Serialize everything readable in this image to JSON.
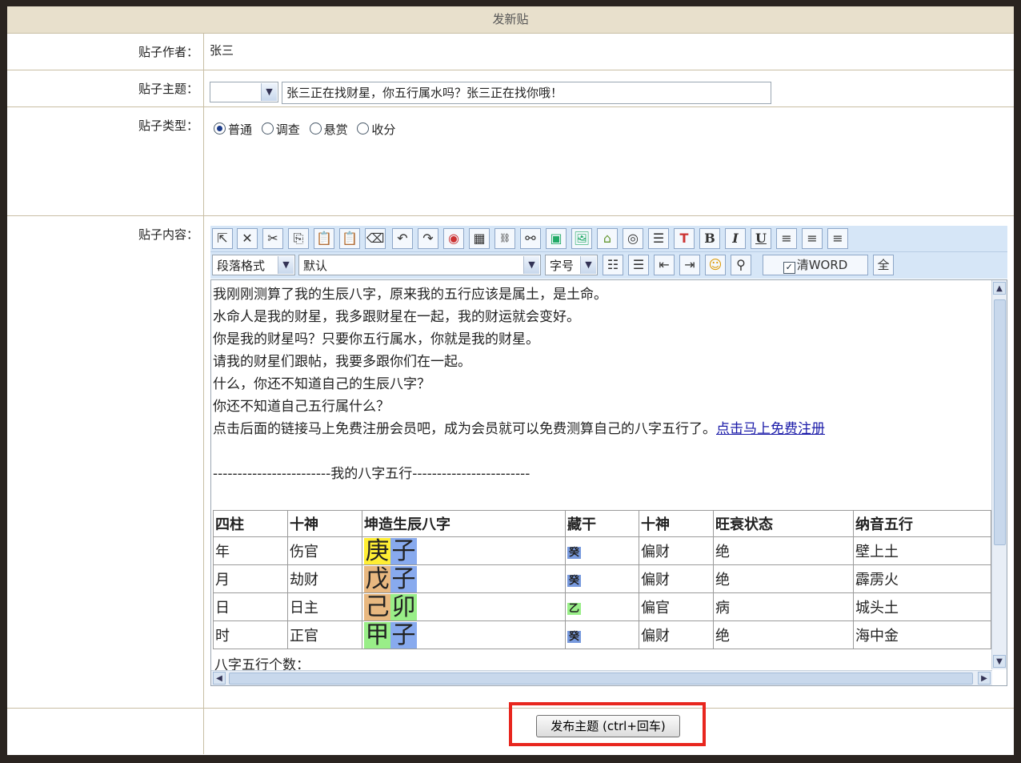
{
  "title": "发新贴",
  "labels": {
    "author": "贴子作者：",
    "subject": "贴子主题：",
    "type": "贴子类型：",
    "content": "贴子内容："
  },
  "author_value": "张三",
  "subject_value": "张三正在找财星，你五行属水吗？张三正在找你哦！",
  "types": [
    {
      "label": "普通",
      "checked": true
    },
    {
      "label": "调查",
      "checked": false
    },
    {
      "label": "悬赏",
      "checked": false
    },
    {
      "label": "收分",
      "checked": false
    }
  ],
  "toolbar2": {
    "paragraph_format": "段落格式",
    "font": "默认",
    "font_size": "字号",
    "clear_word": "清WORD",
    "full": "全"
  },
  "toolbar1_icons": [
    "cursor-icon",
    "delete-icon",
    "cut-icon",
    "copy-icon",
    "paste-icon",
    "paste-text-icon",
    "eraser-icon",
    "undo-icon",
    "redo-icon",
    "stamp-icon",
    "table-icon",
    "web-link-icon",
    "unlink-icon",
    "image-icon",
    "picture-icon",
    "gallery-icon",
    "media-icon",
    "form-icon",
    "text-color-icon",
    "bold-icon",
    "italic-icon",
    "underline-icon",
    "align-left-icon",
    "align-center-icon",
    "align-right-icon"
  ],
  "content_lines": [
    "我刚刚测算了我的生辰八字，原来我的五行应该是属土，是土命。",
    "水命人是我的财星，我多跟财星在一起，我的财运就会变好。",
    "你是我的财星吗？只要你五行属水，你就是我的财星。",
    "请我的财星们跟帖，我要多跟你们在一起。",
    "什么，你还不知道自己的生辰八字？",
    "你还不知道自己五行属什么？",
    "点击后面的链接马上免费注册会员吧，成为会员就可以免费测算自己的八字五行了。"
  ],
  "link_text": "点击马上免费注册",
  "separator": "------------------------我的八字五行------------------------",
  "bazi_table": {
    "headers": [
      "四柱",
      "十神",
      "坤造生辰八字",
      "藏干",
      "十神",
      "旺衰状态",
      "纳音五行"
    ],
    "rows": [
      {
        "pillar": "年",
        "shishen": "伤官",
        "gan": "庚",
        "zhi": "子",
        "gan_color": "#ffee33",
        "zhi_color": "#88aaee",
        "canggan": "癸",
        "canggan_color": "#7799dd",
        "shishen2": "偏财",
        "state": "绝",
        "nayin": "壁上土"
      },
      {
        "pillar": "月",
        "shishen": "劫财",
        "gan": "戊",
        "zhi": "子",
        "gan_color": "#e8b880",
        "zhi_color": "#88aaee",
        "canggan": "癸",
        "canggan_color": "#7799dd",
        "shishen2": "偏财",
        "state": "绝",
        "nayin": "霹雳火"
      },
      {
        "pillar": "日",
        "shishen": "日主",
        "gan": "己",
        "zhi": "卯",
        "gan_color": "#e8b880",
        "zhi_color": "#99ee88",
        "canggan": "乙",
        "canggan_color": "#99ee88",
        "shishen2": "偏官",
        "state": "病",
        "nayin": "城头土"
      },
      {
        "pillar": "时",
        "shishen": "正官",
        "gan": "甲",
        "zhi": "子",
        "gan_color": "#99ee88",
        "zhi_color": "#88aaee",
        "canggan": "癸",
        "canggan_color": "#7799dd",
        "shishen2": "偏财",
        "state": "绝",
        "nayin": "海中金"
      }
    ]
  },
  "trailing_line": "八字五行个数：",
  "submit_label": "发布主题 (ctrl+回车)",
  "highlight_color": "#e8261e"
}
